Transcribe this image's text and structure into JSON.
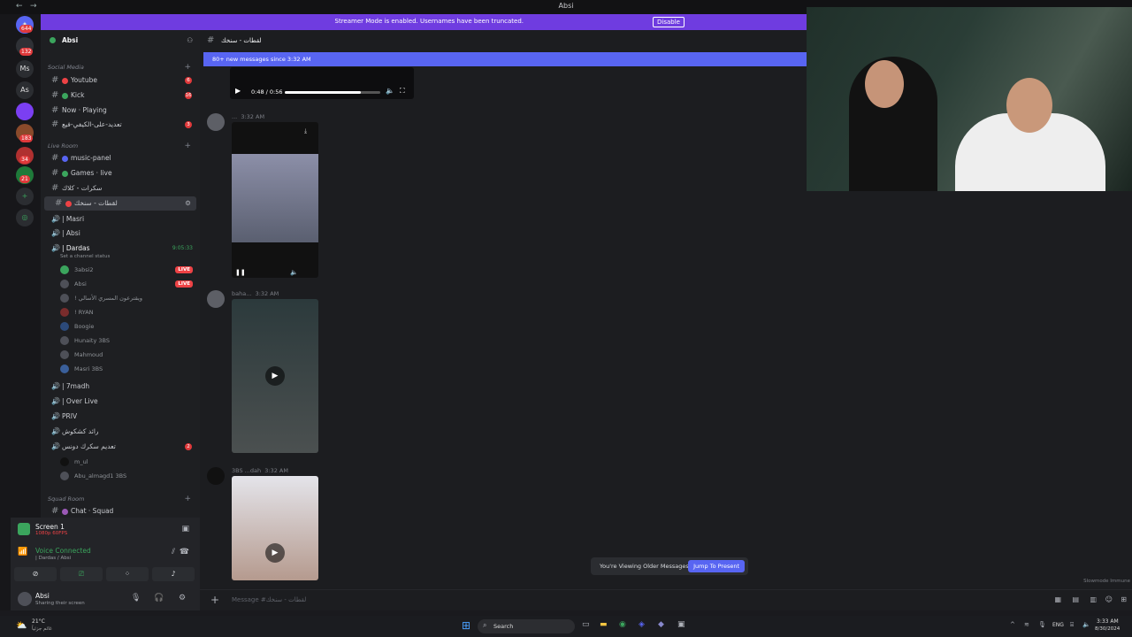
{
  "window": {
    "title": "Absi"
  },
  "banner": {
    "text": "Streamer Mode is enabled. Usernames have been truncated.",
    "button": "Disable"
  },
  "servers": [
    {
      "label": "As",
      "badge": ""
    },
    {
      "label": "Ms",
      "badge": ""
    }
  ],
  "server_badges": [
    "644",
    "132",
    "183",
    "34",
    "21"
  ],
  "sidebar": {
    "server_name": "Absi",
    "categories": {
      "social": "Social Media",
      "live": "Live Room",
      "squad": "Squad Room"
    },
    "channels_social": [
      {
        "label": "Youtube",
        "badge": "6",
        "color": "#ed4245"
      },
      {
        "label": "Kick",
        "badge": "16",
        "color": "#3ba55d"
      },
      {
        "label": "Now · Playing",
        "badge": "",
        "color": "#80848e"
      },
      {
        "label": "تعديد-على-الكيفي-فيع",
        "badge": "3",
        "color": "#80848e"
      }
    ],
    "channels_live": [
      {
        "label": "music-panel",
        "color": "#5865f2"
      },
      {
        "label": "Games · live",
        "color": "#3ba55d"
      },
      {
        "label": "سكرات - كلاك",
        "color": "#80848e"
      },
      {
        "label": "لقطات - سنخك",
        "color": "#ed4245"
      }
    ],
    "voice_top": [
      {
        "label": "| Masri"
      },
      {
        "label": "| Absi"
      },
      {
        "label": "| Dardas"
      }
    ],
    "dardas_time": "9:05:33",
    "status_hint": "Set a channel status",
    "voice_users": [
      {
        "name": "3absi2",
        "live": "LIVE"
      },
      {
        "name": "Absi",
        "live": "LIVE"
      },
      {
        "name": "! ويقترعون المسري الأسالي",
        "live": ""
      },
      {
        "name": "! RYAN",
        "live": ""
      },
      {
        "name": "Boogie",
        "live": ""
      },
      {
        "name": "Hunaity 3BS",
        "live": ""
      },
      {
        "name": "Mahmoud",
        "live": ""
      },
      {
        "name": "Masri 3BS",
        "live": ""
      }
    ],
    "voice_more": [
      {
        "label": "| 7madh"
      },
      {
        "label": "| Over Live"
      },
      {
        "label": "PRIV"
      },
      {
        "label": "رائد كشكوش"
      },
      {
        "label": "تعديم سكرك دونس"
      }
    ],
    "more_users": [
      {
        "name": "m_ul"
      },
      {
        "name": "Abu_almagd1 3BS"
      }
    ],
    "squad_channel": "Chat · Squad",
    "screen": {
      "title": "Screen 1",
      "sub": "1080p 60FPS"
    },
    "voice": {
      "status": "Voice Connected",
      "channel": "| Dardas / Absi"
    },
    "user": {
      "name": "Absi",
      "status": "Sharing their screen"
    }
  },
  "main": {
    "channel_title": "لقطات - سنخك",
    "new_messages": "80+ new messages since 3:32 AM",
    "audio_time": "0:48 / 0:56",
    "messages": [
      {
        "name": "...",
        "time": "3:32 AM"
      },
      {
        "name": "baha...",
        "time": "3:32 AM"
      },
      {
        "name": "3BS ...dah",
        "time": "3:32 AM"
      }
    ],
    "older": "You're Viewing Older Messages",
    "jump": "Jump To Present",
    "composer_placeholder": "Message #لقطات - سنخك",
    "slowmode": "Slowmode Immune"
  },
  "taskbar": {
    "search": "Search",
    "weather": "21°C",
    "weather_sub": "غائم جزئياً",
    "lang": "ENG",
    "time": "3:33 AM",
    "date": "8/30/2024"
  }
}
